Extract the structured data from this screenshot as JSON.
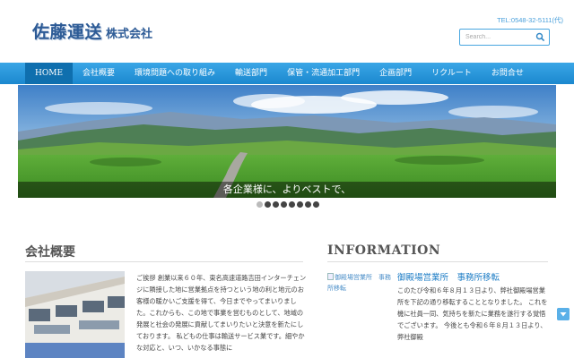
{
  "header": {
    "logo_main": "佐藤運送",
    "logo_sub": "株式会社",
    "tel": "TEL:0548-32-5111(代)",
    "search_placeholder": "Search..."
  },
  "nav": {
    "items": [
      "HOME",
      "会社概要",
      "環境問題への取り組み",
      "輸送部門",
      "保管・流通加工部門",
      "企画部門",
      "リクルート",
      "お問合せ"
    ],
    "active": "HOME"
  },
  "hero": {
    "caption": "各企業様に、よりベストで、",
    "slide_count": 8,
    "active_slide": 1
  },
  "about": {
    "title": "会社概要",
    "text": "ご挨拶 創業以来６０年、東名高速道路吉田インターチェンジに隣接した地に営業拠点を持つという地の利と地元のお客様の暖かいご支援を得て、今日までやってまいりました。これからも、この地で事業を営むものとして、地域の発展と社会の発展に貢献してまいりたいと決意を新たにしております。 私どもの仕事は輸送サービス業です。細やかな対応と、いつ、いかなる事態に"
  },
  "info": {
    "title": "INFORMATION",
    "image_alt": "御殿場営業所　事務所移転",
    "link": "御殿場営業所　事務所移転",
    "text": "このたび令和６年８月１３日より、弊社御殿場営業所を下記の通り移転することとなりました。 これを機に社員一同、気持ちを新たに業務を遂行する覚悟でございます。 今後とも令和６年８月１３日より、弊社御殿"
  },
  "colors": {
    "brand": "#2d5b96",
    "nav": "#1b88cf",
    "nav_active": "#0f6fae",
    "accent": "#48a6e0"
  }
}
